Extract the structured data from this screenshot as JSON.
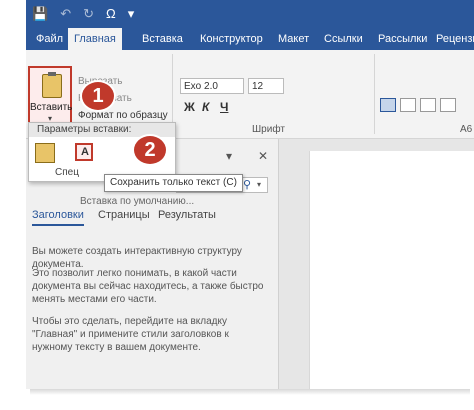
{
  "quick_access": [
    "💾",
    "↶",
    "↻",
    "Ω",
    "▾"
  ],
  "tabs": [
    {
      "label": "Файл",
      "active": false
    },
    {
      "label": "Главная",
      "active": true
    },
    {
      "label": "Вставка",
      "active": false
    },
    {
      "label": "Конструктор",
      "active": false
    },
    {
      "label": "Макет",
      "active": false
    },
    {
      "label": "Ссылки",
      "active": false
    },
    {
      "label": "Рассылки",
      "active": false
    },
    {
      "label": "Рецензиро",
      "active": false
    }
  ],
  "clipboard": {
    "paste_label": "Вставить",
    "cut_label": "Вырезать",
    "copy_label": "Копировать",
    "format_painter_label": "Формат по образцу"
  },
  "font": {
    "font_name": "Exo 2.0",
    "font_size": "12",
    "bold": "Ж",
    "italic": "К",
    "underline": "Ч",
    "group_label": "Шрифт"
  },
  "paragraph": {
    "group_label": "А6"
  },
  "paste_options": {
    "header": "Параметры вставки:",
    "special_label": "Спец",
    "default_label": "Вставка по умолчанию...",
    "option2_glyph": "A"
  },
  "tooltip": "Сохранить только текст (С)",
  "badges": [
    "1",
    "2"
  ],
  "nav_pane": {
    "dropdown": "▾",
    "close": "✕",
    "search_icon": "⚲",
    "tabs": [
      "Заголовки",
      "Страницы",
      "Результаты"
    ],
    "paragraphs": [
      "Вы можете создать интерактивную структуру документа.",
      "Это позволит легко понимать, в какой части документа вы сейчас находитесь, а также быстро менять местами его части.",
      "Чтобы это сделать, перейдите на вкладку \"Главная\" и примените стили заголовков к нужному тексту в вашем документе."
    ]
  },
  "colors": {
    "accent": "#2b579a",
    "highlight": "#c0392b"
  }
}
